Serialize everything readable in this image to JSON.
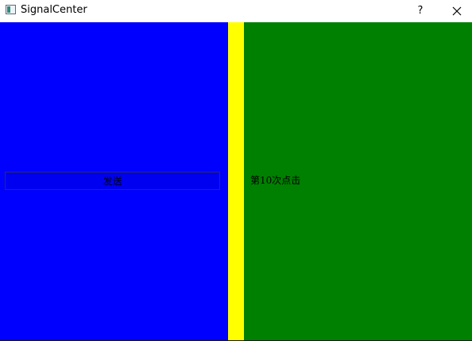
{
  "window": {
    "title": "SignalCenter",
    "help_label": "?"
  },
  "left_panel": {
    "send_button_label": "发送"
  },
  "right_panel": {
    "click_text": "第10次点击"
  },
  "colors": {
    "left_panel": "#0000ff",
    "splitter": "#ffff00",
    "right_panel": "#008000"
  },
  "icons": {
    "app": "app-window-icon",
    "close": "close-icon"
  }
}
